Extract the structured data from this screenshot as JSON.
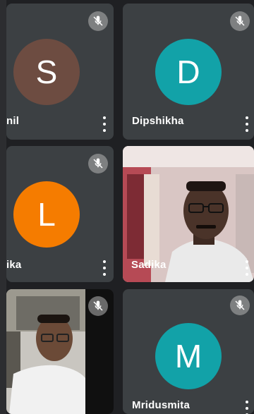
{
  "participants": [
    {
      "initial": "S",
      "name": "nil",
      "avatar_color": "#6d4c41",
      "muted": true
    },
    {
      "initial": "D",
      "name": "Dipshikha",
      "avatar_color": "#12a2a8",
      "muted": true
    },
    {
      "initial": "L",
      "name": "ika",
      "avatar_color": "#f57c00",
      "muted": true
    },
    {
      "initial": "",
      "name": "Sadika",
      "avatar_color": "",
      "muted": false
    },
    {
      "initial": "",
      "name": "",
      "avatar_color": "",
      "muted": true
    },
    {
      "initial": "M",
      "name": "Mridusmita",
      "avatar_color": "#12a2a8",
      "muted": true
    }
  ],
  "icons": {
    "mute": "mic-off-icon",
    "more": "more-vert-icon"
  }
}
